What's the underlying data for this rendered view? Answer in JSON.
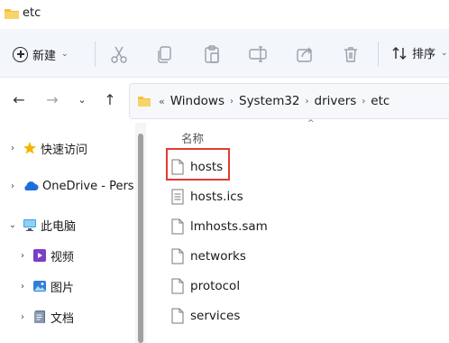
{
  "window": {
    "title": "etc"
  },
  "toolbar": {
    "new_label": "新建",
    "sort_label": "排序",
    "icons": [
      "cut-icon",
      "copy-icon",
      "paste-icon",
      "rename-icon",
      "share-icon",
      "delete-icon"
    ]
  },
  "navigation": {
    "back": "←",
    "forward": "→",
    "recent": "⌄",
    "up": "↑"
  },
  "address": {
    "overflow": "«",
    "crumbs": [
      "Windows",
      "System32",
      "drivers",
      "etc"
    ]
  },
  "sidebar": {
    "items": [
      {
        "label": "快速访问",
        "icon": "star-icon"
      },
      {
        "label": "OneDrive - Pers",
        "icon": "cloud-icon"
      },
      {
        "label": "此电脑",
        "icon": "computer-icon"
      },
      {
        "label": "视频",
        "icon": "video-icon"
      },
      {
        "label": "图片",
        "icon": "pictures-icon"
      },
      {
        "label": "文档",
        "icon": "documents-icon"
      }
    ]
  },
  "file_list": {
    "column_name": "名称",
    "files": [
      "hosts",
      "hosts.ics",
      "lmhosts.sam",
      "networks",
      "protocol",
      "services"
    ]
  },
  "colors": {
    "folder": "#f3c23b",
    "highlight": "#e53935",
    "accent": "#1e6fd9"
  }
}
